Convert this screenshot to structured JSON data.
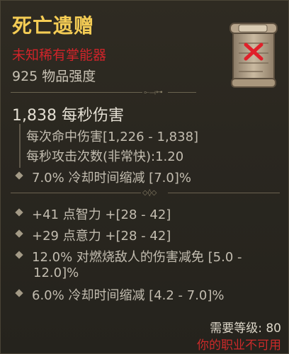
{
  "item": {
    "name": "死亡遗赠",
    "unknown_label": "未知稀有掌能器",
    "power": "925 物品强度",
    "icon": "scroll-icon"
  },
  "stats": {
    "dps": "1,838 每秒伤害",
    "damage_per_hit": "每次命中伤害[1,226 - 1,838]",
    "attacks_per_second": "每秒攻击次数(非常快):1.20",
    "implicit": "7.0% 冷却时间缩减 [7.0]%"
  },
  "affixes": [
    {
      "text": "+41 点智力 +[28 - 42]"
    },
    {
      "text": "+29 点意力 +[28 - 42]"
    },
    {
      "text": "12.0% 对燃烧敌人的伤害减免 [5.0 -",
      "continuation": "12.0]%"
    },
    {
      "text": "6.0% 冷却时间缩减 [4.2 - 7.0]%"
    }
  ],
  "requirements": {
    "level": "需要等级: 80",
    "class_warning": "你的职业不可用"
  },
  "colors": {
    "title": "#f4cc55",
    "unknown": "#d0242a",
    "warning": "#cc2a2a",
    "background": "#2a2720"
  }
}
